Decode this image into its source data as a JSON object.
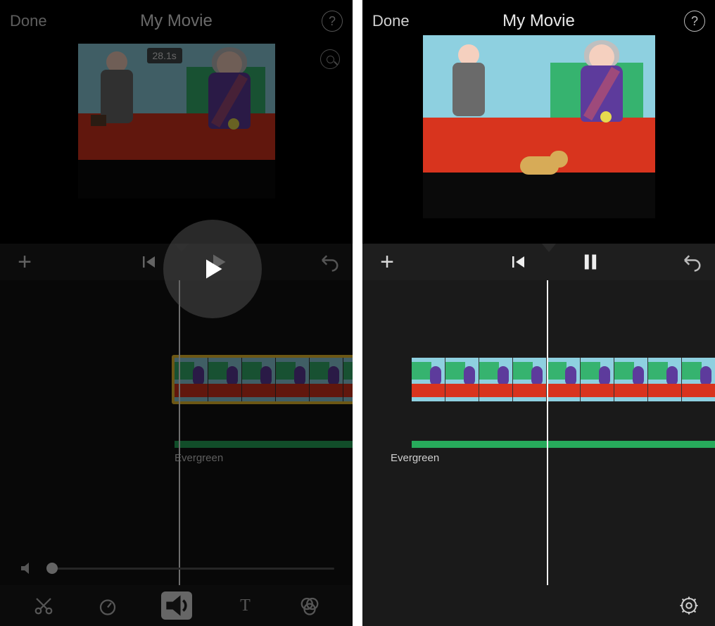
{
  "left": {
    "header": {
      "done": "Done",
      "title": "My Movie"
    },
    "clip_duration_badge": "28.1s",
    "audio_track_label": "Evergreen",
    "volume_level_percent": 0,
    "bottom_tabs": [
      "cut",
      "speed",
      "audio",
      "text",
      "filters"
    ],
    "bottom_tab_active": "audio",
    "playback_state": "paused"
  },
  "right": {
    "header": {
      "done": "Done",
      "title": "My Movie"
    },
    "audio_track_label": "Evergreen",
    "playback_state": "playing"
  },
  "colors": {
    "accent_yellow": "#f0c030",
    "audio_green": "#27aa5b"
  }
}
